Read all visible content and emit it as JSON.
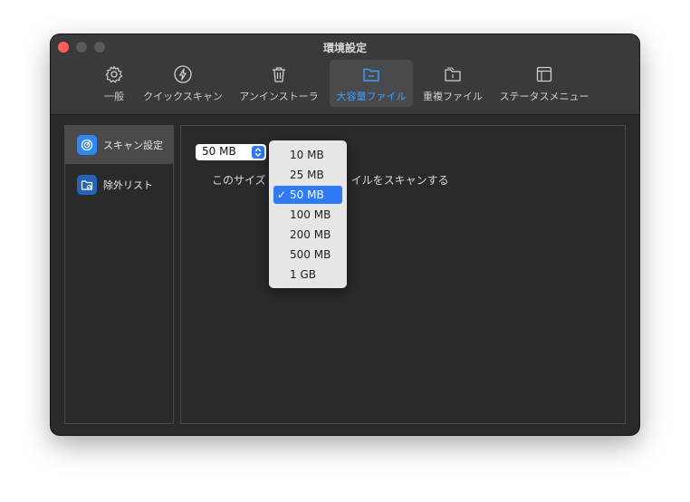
{
  "window": {
    "title": "環境設定"
  },
  "toolbar": {
    "tabs": [
      {
        "label": "一般",
        "icon": "gear-icon"
      },
      {
        "label": "クイックスキャン",
        "icon": "lightning-icon"
      },
      {
        "label": "アンインストーラ",
        "icon": "trash-icon"
      },
      {
        "label": "大容量ファイル",
        "icon": "folder-icon",
        "active": true
      },
      {
        "label": "重複ファイル",
        "icon": "duplicate-folder-icon"
      },
      {
        "label": "ステータスメニュー",
        "icon": "layout-icon"
      }
    ]
  },
  "sidebar": {
    "items": [
      {
        "label": "スキャン設定",
        "icon": "radar-icon",
        "selected": true
      },
      {
        "label": "除外リスト",
        "icon": "excluded-folder-icon"
      }
    ]
  },
  "content": {
    "size_select": {
      "value": "50 MB"
    },
    "description_before": "このサイズ",
    "description_after": "イルをスキャンする"
  },
  "dropdown": {
    "options": [
      "10 MB",
      "25 MB",
      "50 MB",
      "100 MB",
      "200 MB",
      "500 MB",
      "1 GB"
    ],
    "selected_index": 2,
    "checkmark": "✓"
  },
  "colors": {
    "accent": "#3aa0ff",
    "selection": "#2f7bf6",
    "window_bg": "#2a2a2c",
    "toolbar_bg": "#3a3a3c"
  }
}
